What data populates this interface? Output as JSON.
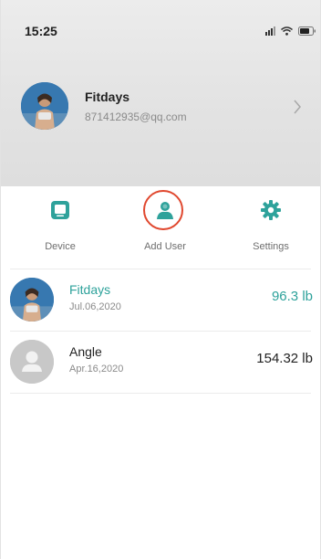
{
  "status_bar": {
    "time": "15:25"
  },
  "profile": {
    "name": "Fitdays",
    "email": "871412935@qq.com"
  },
  "menu": [
    {
      "label": "Device",
      "icon": "device-icon"
    },
    {
      "label": "Add User",
      "icon": "add-user-icon"
    },
    {
      "label": "Settings",
      "icon": "settings-icon"
    }
  ],
  "users": [
    {
      "name": "Fitdays",
      "date": "Jul.06,2020",
      "weight": "96.3 lb",
      "selected": true
    },
    {
      "name": "Angle",
      "date": "Apr.16,2020",
      "weight": "154.32 lb",
      "selected": false
    }
  ],
  "colors": {
    "accent": "#2ea29b",
    "highlight_ring": "#e0472e"
  }
}
